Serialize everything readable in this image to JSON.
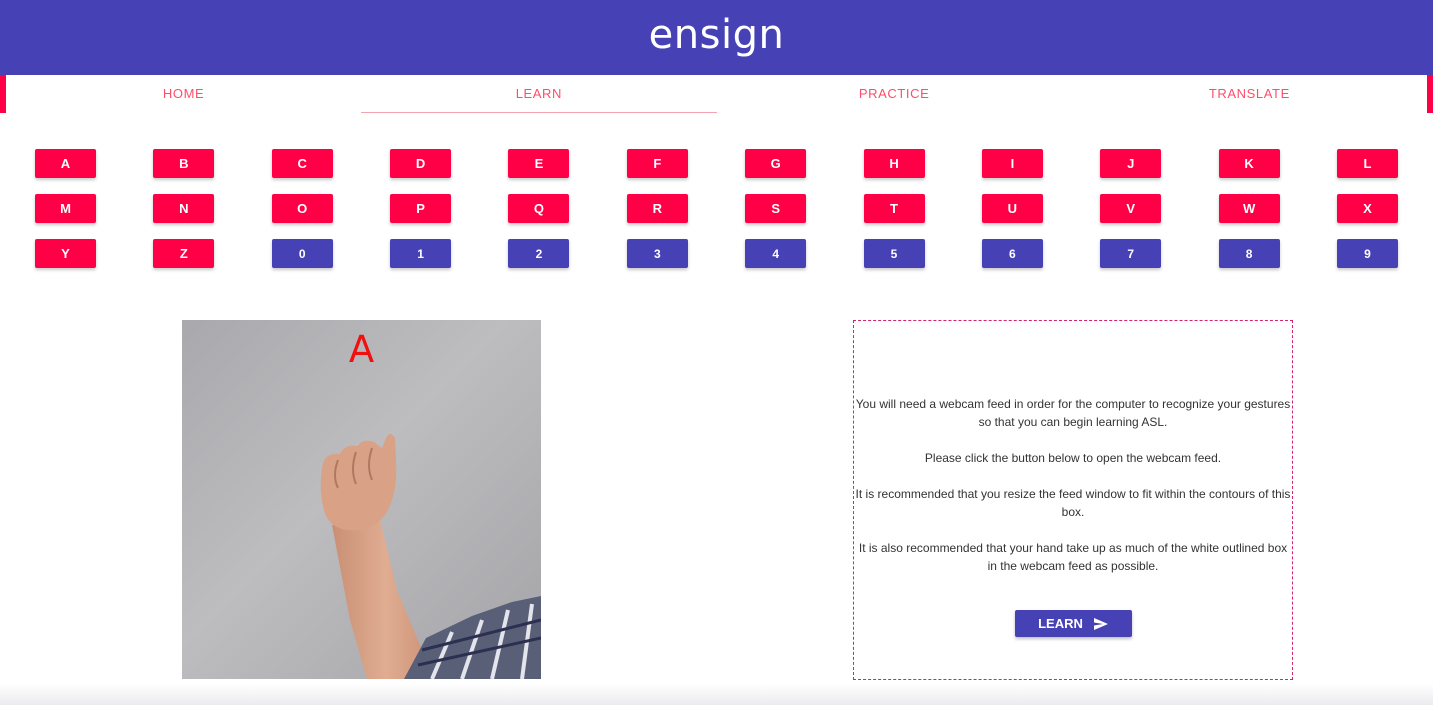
{
  "header": {
    "brand": "ensign"
  },
  "nav": {
    "tabs": [
      {
        "label": "HOME"
      },
      {
        "label": "LEARN"
      },
      {
        "label": "PRACTICE"
      },
      {
        "label": "TRANSLATE"
      }
    ],
    "active_tab": "LEARN"
  },
  "keys": {
    "letters": [
      "A",
      "B",
      "C",
      "D",
      "E",
      "F",
      "G",
      "H",
      "I",
      "J",
      "K",
      "L",
      "M",
      "N",
      "O",
      "P",
      "Q",
      "R",
      "S",
      "T",
      "U",
      "V",
      "W",
      "X",
      "Y",
      "Z"
    ],
    "digits": [
      "0",
      "1",
      "2",
      "3",
      "4",
      "5",
      "6",
      "7",
      "8",
      "9"
    ]
  },
  "sign_image": {
    "letter": "A"
  },
  "webcam": {
    "instructions": [
      "You will need a webcam feed in order for the computer to recognize your gestures so that you can begin learning ASL.",
      "Please click the button below to open the webcam feed.",
      "It is recommended that you resize the feed window to fit within the contours of this box.",
      "It is also recommended that your hand take up as much of the white outlined box in the webcam feed as possible."
    ],
    "button_label": "LEARN",
    "button_icon": "send-icon"
  },
  "colors": {
    "primary": "#4642b6",
    "accent": "#ff0046",
    "tab_text": "#ff4d6a",
    "sign_letter": "#f01010"
  }
}
